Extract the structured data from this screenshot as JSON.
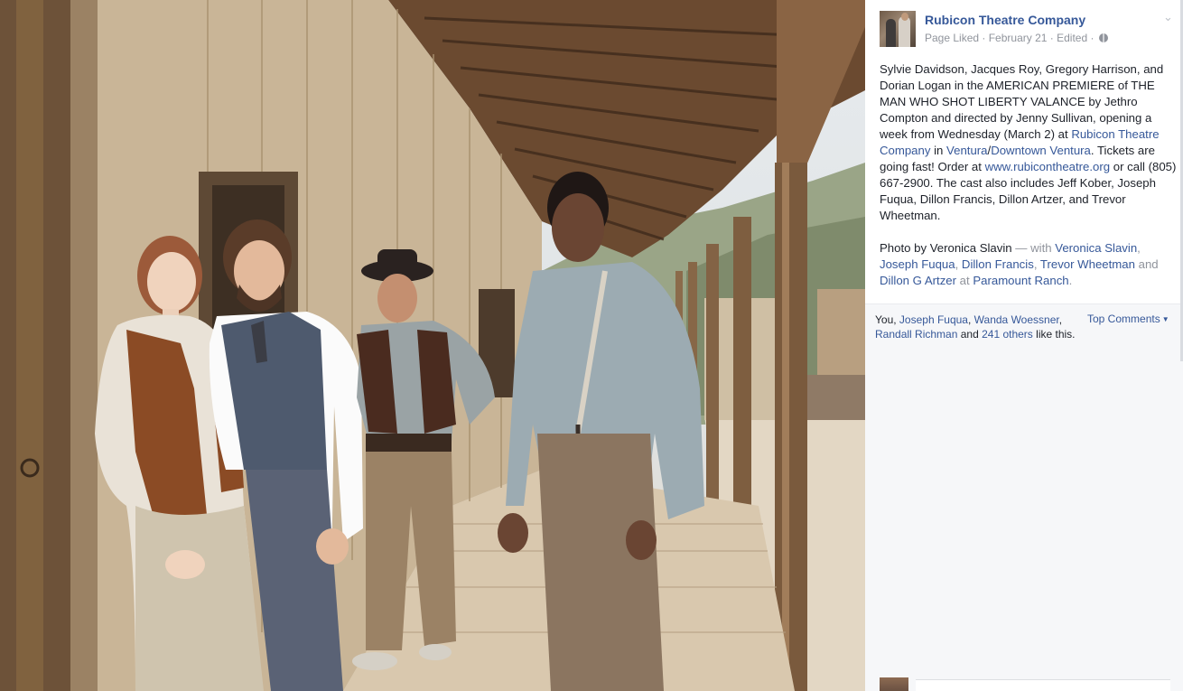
{
  "photo": {
    "description_icon": "theatre-cast-photo",
    "colors": {
      "wood_dark": "#5b4632",
      "wood_light": "#b8a48a",
      "sky": "#e7ebee",
      "ground": "#e2d9ca"
    }
  },
  "post": {
    "page_name": "Rubicon Theatre Company",
    "meta": {
      "status": "Page Liked",
      "sep1": " · ",
      "date": "February 21",
      "sep2": " · ",
      "edited": "Edited",
      "sep3": " · "
    },
    "body": {
      "t1": "Sylvie Davidson, Jacques Roy, Gregory Harrison, and Dorian Logan in the AMERICAN PREMIERE of THE MAN WHO SHOT LIBERTY VALANCE by Jethro Compton and directed by Jenny Sullivan, opening a week from Wednesday (March 2) at ",
      "link_rubicon": "Rubicon Theatre Company",
      "t2": " in ",
      "link_ventura": "Ventura",
      "t3": "/",
      "link_downtown": "Downtown Ventura",
      "t4": ". Tickets are going fast! Order at ",
      "link_site": "www.rubicontheatre.org",
      "t5": " or call (805) 667-2900. The cast also includes Jeff Kober, Joseph Fuqua, Dillon Francis, Dillon Artzer, and Trevor Wheetman."
    },
    "credits": {
      "photo_by": "Photo by Veronica Slavin",
      "with": " — with ",
      "tag1": "Veronica Slavin",
      "c1": ", ",
      "tag2": "Joseph Fuqua",
      "c2": ", ",
      "tag3": "Dillon Francis",
      "c3": ", ",
      "tag4": "Trevor Wheetman",
      "and": " and ",
      "tag5": "Dillon G Artzer",
      "at": " at ",
      "place": "Paramount Ranch",
      "period": "."
    }
  },
  "likes": {
    "prefix": "You, ",
    "name1": "Joseph Fuqua",
    "c1": ", ",
    "name2": "Wanda Woessner",
    "c2": ",",
    "name3": "Randall Richman",
    "and": " and ",
    "others": "241 others",
    "suffix": " like this.",
    "top_comments": "Top Comments"
  },
  "colors": {
    "link": "#365899",
    "meta": "#90949c",
    "text": "#1d2129",
    "likes_bg": "#f6f7f9"
  }
}
